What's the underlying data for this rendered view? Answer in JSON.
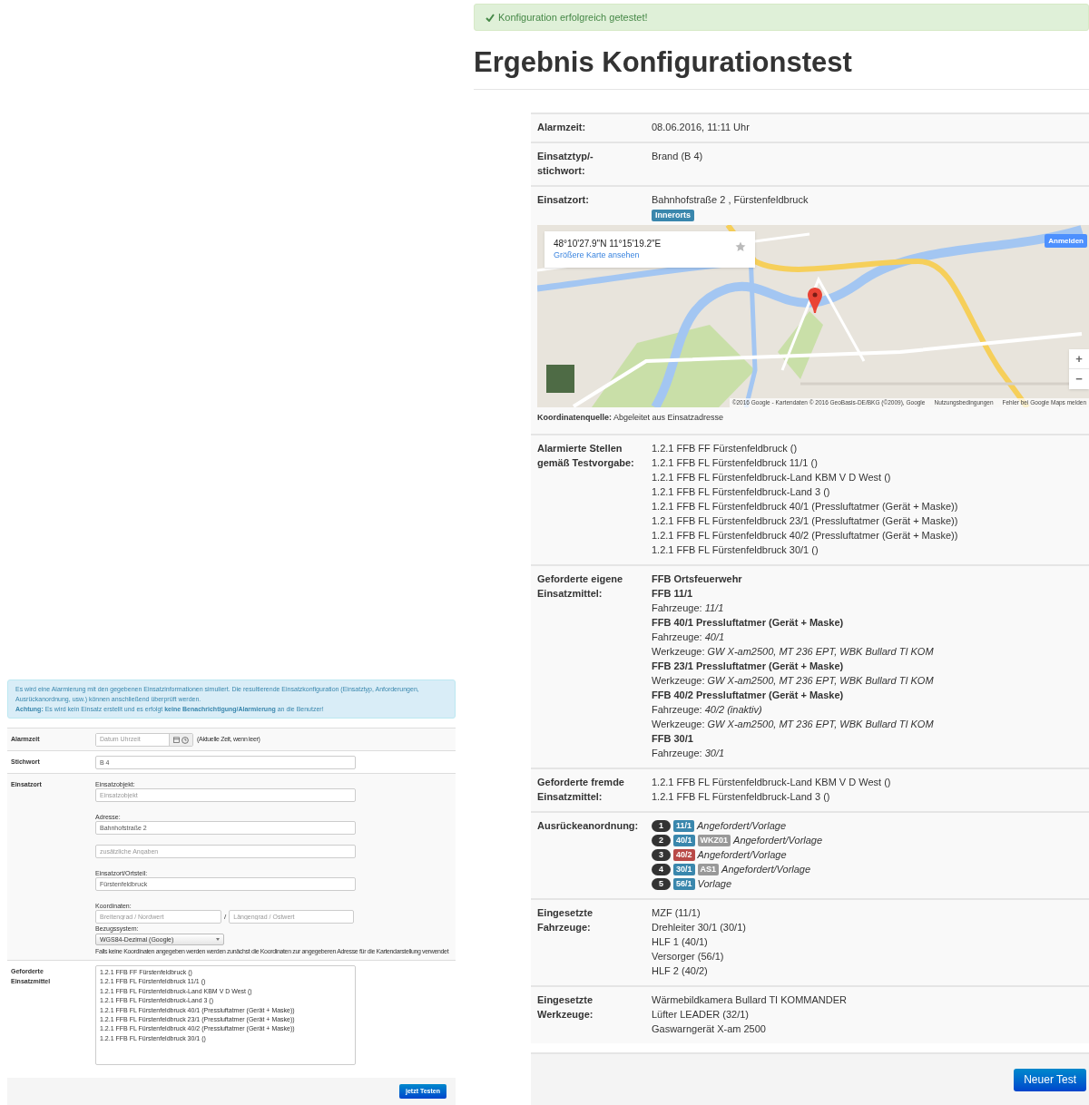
{
  "simulation_form": {
    "info": [
      "Es wird eine Alarmierung mit den gegebenen Einsatzinformationen simuliert. Die resultierende Einsatzkonfiguration (Einsatztyp, Anforderungen, Ausrückanordnung, usw.) können anschließend überprüft werden.",
      "**Achtung:** Es wird kein Einsatz erstellt und es erfolgt **keine Benachrichtigung/Alarmierung** an die Benutzer!"
    ],
    "alarm_time": {
      "label": "Alarmzeit",
      "placeholder": "Datum Uhrzeit",
      "hint": "(Aktuelle Zeit, wenn leer)"
    },
    "keyword": {
      "label": "Stichwort",
      "value": "B 4"
    },
    "location": {
      "label": "Einsatzort",
      "object_label": "Einsatzobjekt:",
      "object_placeholder": "Einsatzobjekt",
      "address_label": "Adresse:",
      "address_value": "Bahnhofstraße 2",
      "extra_placeholder": "zusätzliche Angaben",
      "district_label": "Einsatzort/Ortsteil:",
      "district_value": "Fürstenfeldbruck",
      "coords_label": "Koordinaten:",
      "lat_placeholder": "Breitengrad / Nordwert",
      "separator": "/",
      "lon_placeholder": "Längengrad / Ostwert",
      "system_label": "Bezugssystem:",
      "system_value": "WGS84-Dezimal (Google)",
      "coords_hint": "Falls keine Koordinaten angegeben werden werden zunächst die Koordinaten zur angegeberen Adresse für die Kartendarstellung verwendet"
    },
    "resources": {
      "label": "Geforderte Einsatzmittel",
      "lines": [
        "1.2.1 FFB FF Fürstenfeldbruck ()",
        "1.2.1 FFB FL Fürstenfeldbruck 11/1 ()",
        "1.2.1 FFB FL Fürstenfeldbruck-Land KBM V D West ()",
        "1.2.1 FFB FL Fürstenfeldbruck-Land 3 ()",
        "1.2.1 FFB FL Fürstenfeldbruck 40/1 (Pressluftatmer (Gerät + Maske))",
        "1.2.1 FFB FL Fürstenfeldbruck 23/1 (Pressluftatmer (Gerät + Maske))",
        "1.2.1 FFB FL Fürstenfeldbruck 40/2 (Pressluftatmer (Gerät + Maske))",
        "1.2.1 FFB FL Fürstenfeldbruck 30/1 ()"
      ]
    },
    "submit": "jetzt Testen"
  },
  "alert": {
    "text": "Konfiguration erfolgreich getestet!"
  },
  "title": "Ergebnis Konfigurationstest",
  "result_rows": [
    {
      "kind": "text",
      "label": "Alarmzeit:",
      "lines": [
        "08.06.2016, 11:11 Uhr"
      ]
    },
    {
      "kind": "text",
      "label": "Einsatztyp/-stichwort:",
      "lines": [
        "Brand (B 4)"
      ]
    },
    {
      "kind": "location",
      "label": "Einsatzort:",
      "address": "Bahnhofstraße 2 , Fürstenfeldbruck",
      "badge": "Innerorts",
      "map": {
        "kind": "picture",
        "coordinates": "48°10'27.9\"N 11°15'19.2\"E",
        "link": "Größere Karte ansehen",
        "sign_in": "Anmelden",
        "zoom_in": "+",
        "zoom_out": "−",
        "attribution": "©2016 Google - Kartendaten © 2016 GeoBasis-DE/BKG (©2009), Google",
        "terms": "Nutzungsbedingungen",
        "report": "Fehler bei Google Maps melden"
      },
      "source_label": "Koordinatenquelle:",
      "source": "Abgeleitet aus Einsatzadresse"
    },
    {
      "kind": "text",
      "label": "Alarmierte Stellen gemäß Testvorgabe:",
      "lines": [
        "1.2.1 FFB FF Fürstenfeldbruck ()",
        "1.2.1 FFB FL Fürstenfeldbruck 11/1 ()",
        "1.2.1 FFB FL Fürstenfeldbruck-Land KBM V D West ()",
        "1.2.1 FFB FL Fürstenfeldbruck-Land 3 ()",
        "1.2.1 FFB FL Fürstenfeldbruck 40/1 (Pressluftatmer (Gerät + Maske))",
        "1.2.1 FFB FL Fürstenfeldbruck 23/1 (Pressluftatmer (Gerät + Maske))",
        "1.2.1 FFB FL Fürstenfeldbruck 40/2 (Pressluftatmer (Gerät + Maske))",
        "1.2.1 FFB FL Fürstenfeldbruck 30/1 ()"
      ]
    },
    {
      "kind": "resources",
      "label": "Geforderte eigene Einsatzmittel:",
      "items": [
        {
          "kind": "unit",
          "text": "FFB Ortsfeuerwehr"
        },
        {
          "kind": "unit",
          "text": "FFB 11/1"
        },
        {
          "kind": "detail",
          "text": "Fahrzeuge: *11/1*"
        },
        {
          "kind": "unit",
          "text": "FFB 40/1 Pressluftatmer (Gerät + Maske)"
        },
        {
          "kind": "detail",
          "text": "Fahrzeuge: *40/1*"
        },
        {
          "kind": "detail",
          "text": "Werkzeuge: *GW X-am2500, MT 236 EPT, WBK Bullard TI KOM*"
        },
        {
          "kind": "unit",
          "text": "FFB 23/1 Pressluftatmer (Gerät + Maske)"
        },
        {
          "kind": "detail",
          "text": "Werkzeuge: *GW X-am2500, MT 236 EPT, WBK Bullard TI KOM*"
        },
        {
          "kind": "unit",
          "text": "FFB 40/2 Pressluftatmer (Gerät + Maske)"
        },
        {
          "kind": "detail",
          "text": "Fahrzeuge: *40/2 (inaktiv)*"
        },
        {
          "kind": "detail",
          "text": "Werkzeuge: *GW X-am2500, MT 236 EPT, WBK Bullard TI KOM*"
        },
        {
          "kind": "unit",
          "text": "FFB 30/1"
        },
        {
          "kind": "detail",
          "text": "Fahrzeuge: *30/1*"
        }
      ]
    },
    {
      "kind": "text",
      "label": "Geforderte fremde Einsatzmittel:",
      "lines": [
        "1.2.1 FFB FL Fürstenfeldbruck-Land KBM V D West ()",
        "1.2.1 FFB FL Fürstenfeldbruck-Land 3 ()"
      ]
    },
    {
      "kind": "dispatch",
      "label": "Ausrückeanordnung:",
      "entries": [
        {
          "number": "1",
          "unit": "11/1",
          "color": "#3a87ad",
          "status": "Angefordert/Vorlage"
        },
        {
          "number": "2",
          "unit": "40/1",
          "color": "#3a87ad",
          "tag": "WKZ01",
          "status": "Angefordert/Vorlage"
        },
        {
          "number": "3",
          "unit": "40/2",
          "color": "#b94a48",
          "status": "Angefordert/Vorlage"
        },
        {
          "number": "4",
          "unit": "30/1",
          "color": "#3a87ad",
          "tag": "AS1",
          "status": "Angefordert/Vorlage"
        },
        {
          "number": "5",
          "unit": "56/1",
          "color": "#3a87ad",
          "status": "Vorlage"
        }
      ]
    },
    {
      "kind": "text",
      "label": "Eingesetzte Fahrzeuge:",
      "lines": [
        "MZF (11/1)",
        "Drehleiter 30/1 (30/1)",
        "HLF 1 (40/1)",
        "Versorger (56/1)",
        "HLF 2 (40/2)"
      ]
    },
    {
      "kind": "text",
      "label": "Eingesetzte Werkzeuge:",
      "lines": [
        "Wärmebildkamera Bullard TI KOMMANDER",
        "Lüfter LEADER (32/1)",
        "Gaswarngerät X-am 2500"
      ]
    }
  ],
  "new_test": "Neuer Test"
}
